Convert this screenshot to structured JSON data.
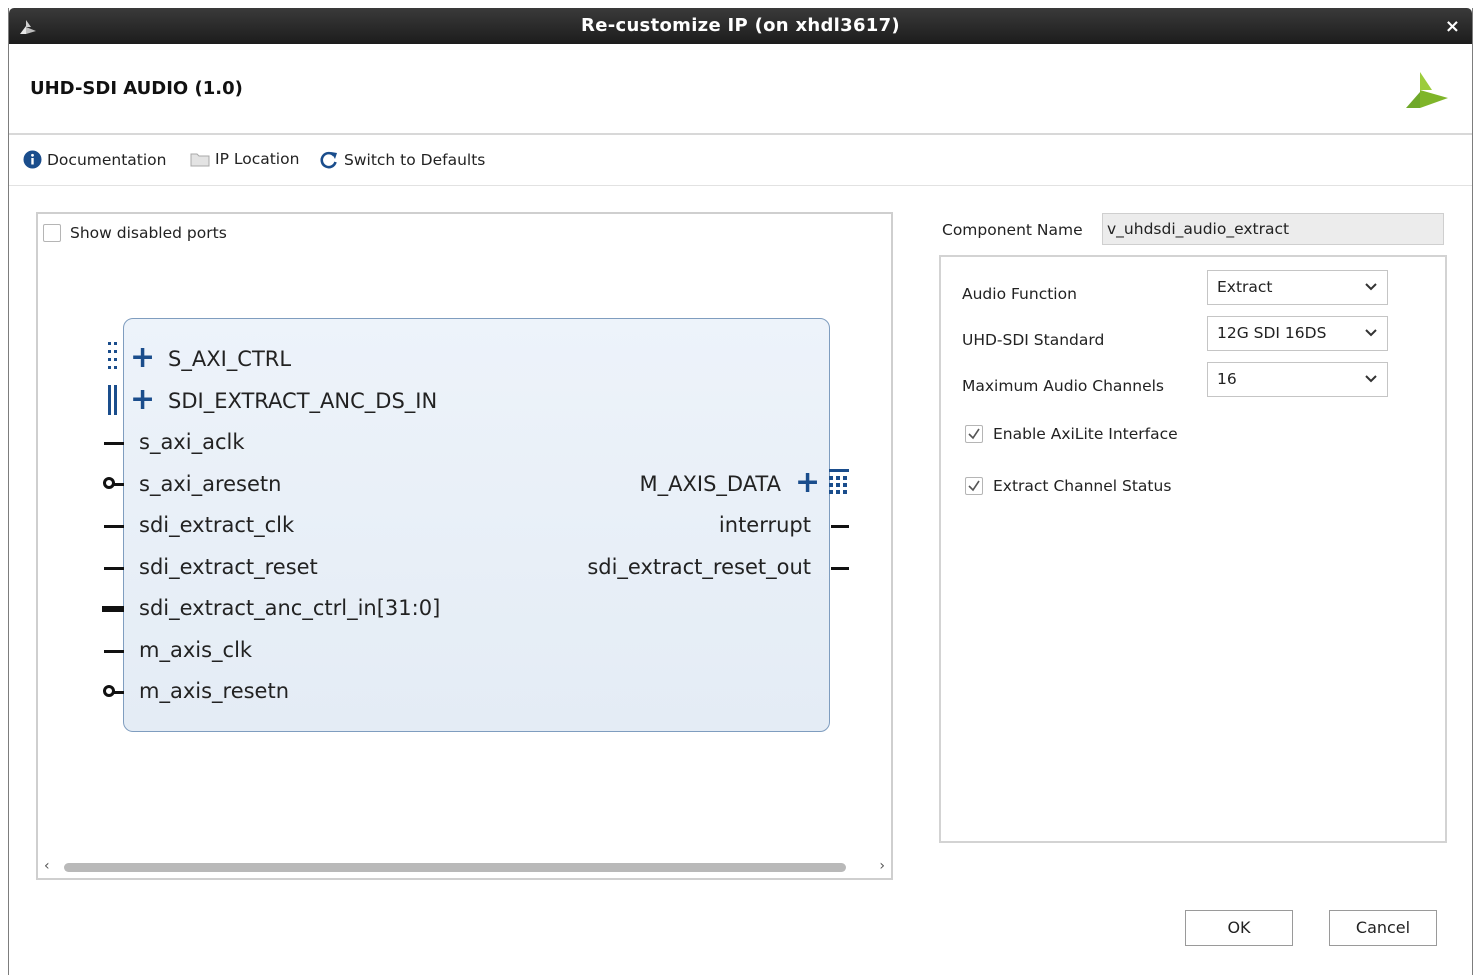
{
  "window": {
    "title": "Re-customize IP (on xhdl3617)",
    "close_glyph": "×",
    "app_icon": "xilinx-logo-icon"
  },
  "header": {
    "ip_title": "UHD-SDI AUDIO (1.0)",
    "brand_icon": "xilinx-logo-icon"
  },
  "toolbar": {
    "documentation": "Documentation",
    "ip_location": "IP Location",
    "switch_defaults": "Switch to Defaults"
  },
  "diagram": {
    "show_disabled_ports": "Show disabled ports",
    "show_disabled_checked": false,
    "left_ports": [
      {
        "name": "S_AXI_CTRL",
        "kind": "interface"
      },
      {
        "name": "SDI_EXTRACT_ANC_DS_IN",
        "kind": "interface"
      },
      {
        "name": "s_axi_aclk",
        "kind": "pin"
      },
      {
        "name": "s_axi_aresetn",
        "kind": "neg"
      },
      {
        "name": "sdi_extract_clk",
        "kind": "pin"
      },
      {
        "name": "sdi_extract_reset",
        "kind": "pin"
      },
      {
        "name": "sdi_extract_anc_ctrl_in[31:0]",
        "kind": "bus"
      },
      {
        "name": "m_axis_clk",
        "kind": "pin"
      },
      {
        "name": "m_axis_resetn",
        "kind": "neg"
      }
    ],
    "right_ports": [
      {
        "name": "M_AXIS_DATA",
        "kind": "interface"
      },
      {
        "name": "interrupt",
        "kind": "pin"
      },
      {
        "name": "sdi_extract_reset_out",
        "kind": "pin"
      }
    ],
    "scroll_left": "‹",
    "scroll_right": "›"
  },
  "params": {
    "component_name_label": "Component Name",
    "component_name_value": "v_uhdsdi_audio_extract",
    "audio_function_label": "Audio Function",
    "audio_function_value": "Extract",
    "standard_label": "UHD-SDI Standard",
    "standard_value": "12G SDI 16DS",
    "max_channels_label": "Maximum Audio Channels",
    "max_channels_value": "16",
    "enable_axilite_label": "Enable AxiLite Interface",
    "enable_axilite_checked": true,
    "extract_status_label": "Extract Channel Status",
    "extract_status_checked": true
  },
  "buttons": {
    "ok": "OK",
    "cancel": "Cancel"
  },
  "colors": {
    "titlebar": "#2a2a2a",
    "block_fill": "#e8eff7",
    "block_border": "#7f9dbf",
    "interface_blue": "#1a4d8c",
    "info_blue": "#1a4d8c",
    "xilinx_green": "#7fb52a"
  }
}
